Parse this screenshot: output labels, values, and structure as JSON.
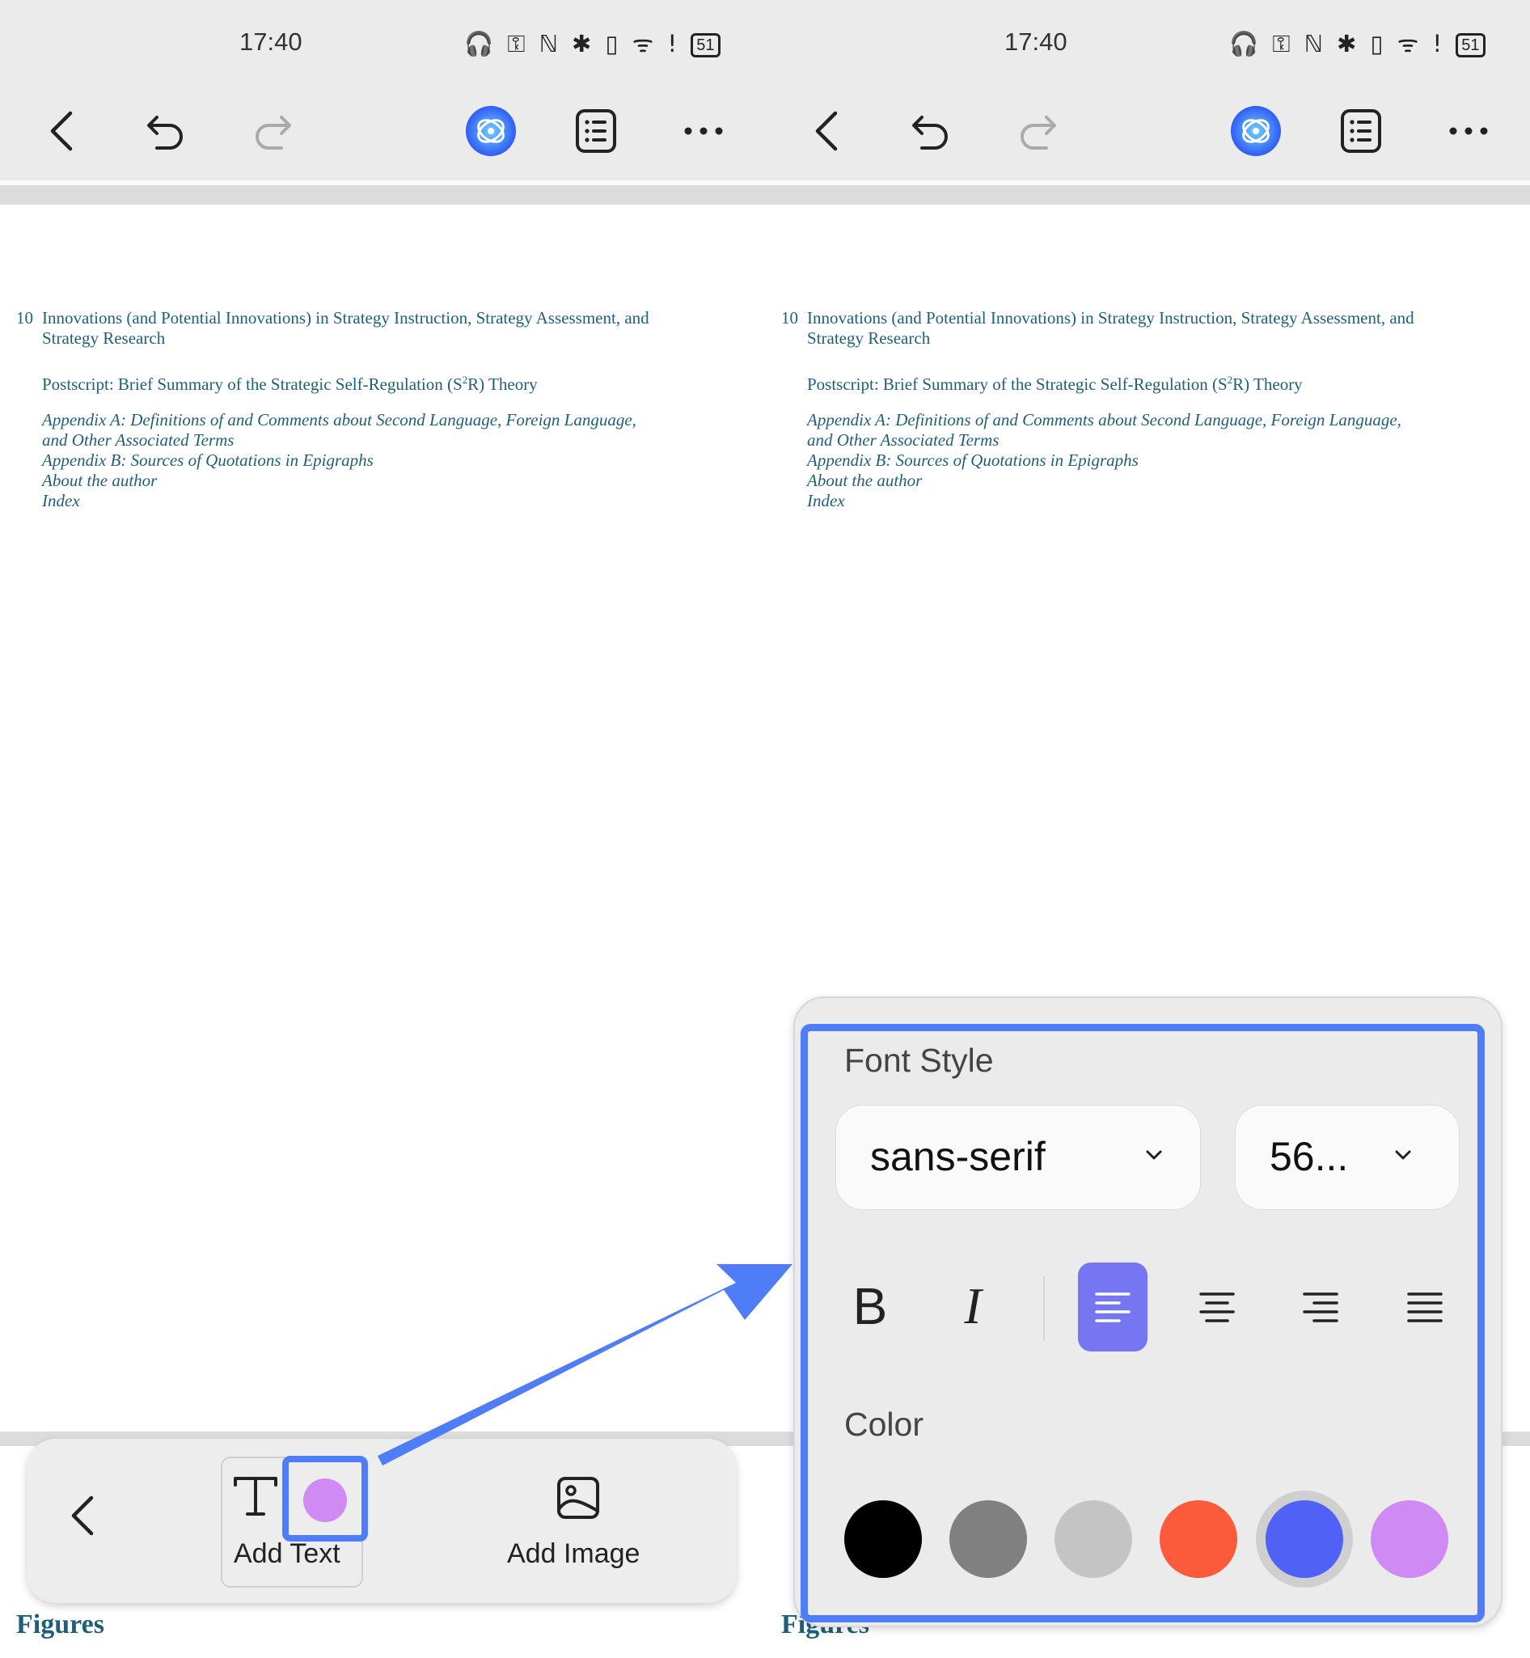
{
  "status": {
    "time": "17:40",
    "icons_text": "🎧 ⚿ ℕ ✱ ▯ ᯤ !",
    "battery": "51"
  },
  "toolbar": {
    "icons": [
      "back-arrow-icon",
      "undo-icon",
      "redo-icon",
      "ai-assistant-icon",
      "outline-list-icon",
      "more-icon"
    ]
  },
  "document": {
    "toc_number": "10",
    "toc_line1": "Innovations (and Potential Innovations) in Strategy Instruction, Strategy Assessment, and",
    "toc_line1b": "Strategy Research",
    "postscript_pre": "Postscript: Brief Summary of the Strategic Self-Regulation (S",
    "postscript_sup": "2",
    "postscript_post": "R) Theory",
    "appendix_a1": "Appendix A: Definitions of and Comments about Second Language, Foreign Language,",
    "appendix_a2": "and Other Associated Terms",
    "appendix_b": "Appendix B: Sources of Quotations in Epigraphs",
    "about": "About the author",
    "index": "Index",
    "figures": "Figures",
    "figures_partial": "Figures"
  },
  "tool_panel": {
    "add_text_label": "Add Text",
    "add_image_label": "Add Image",
    "current_color": "#cf8bf3"
  },
  "font_panel": {
    "title": "Font Style",
    "font_family_value": "sans-serif",
    "font_size_value": "56...",
    "bold_label": "B",
    "italic_label": "I",
    "color_title": "Color",
    "colors": [
      "#000000",
      "#808080",
      "#c4c4c4",
      "#fb5b3a",
      "#4f62f5",
      "#cf8bf3"
    ],
    "selected_color": "#4f62f5",
    "active_alignment": "align-left"
  },
  "accent": "#4f7cf7"
}
